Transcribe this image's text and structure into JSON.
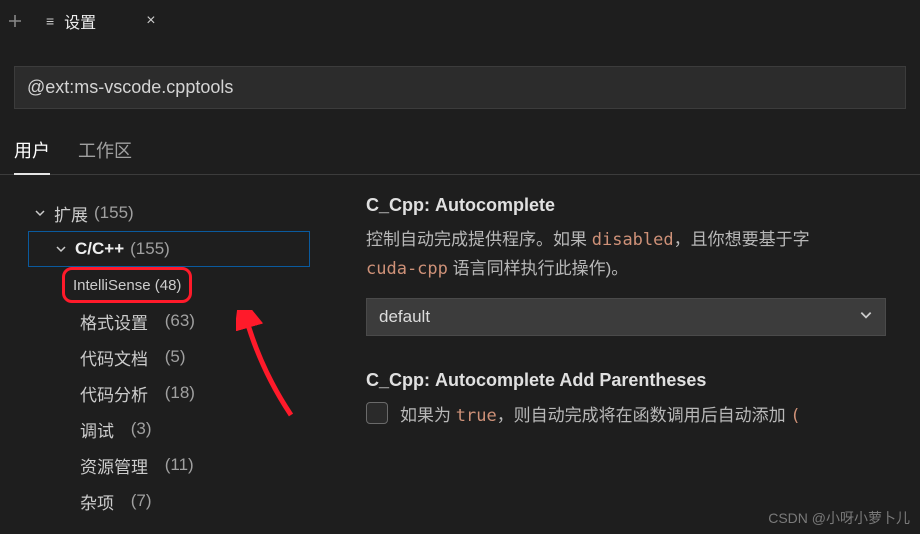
{
  "tab": {
    "icon": "≡",
    "label": "设置",
    "close": "×"
  },
  "search": {
    "value": "@ext:ms-vscode.cpptools"
  },
  "scopes": {
    "user": "用户",
    "workspace": "工作区"
  },
  "tree": {
    "expand": {
      "label": "扩展",
      "count": "(155)"
    },
    "ccpp": {
      "label": "C/C++",
      "count": "(155)"
    },
    "items": [
      {
        "label": "IntelliSense",
        "count": "(48)"
      },
      {
        "label": "格式设置",
        "count": "(63)"
      },
      {
        "label": "代码文档",
        "count": "(5)"
      },
      {
        "label": "代码分析",
        "count": "(18)"
      },
      {
        "label": "调试",
        "count": "(3)"
      },
      {
        "label": "资源管理",
        "count": "(11)"
      },
      {
        "label": "杂项",
        "count": "(7)"
      }
    ]
  },
  "settings": {
    "autocomplete": {
      "prefix": "C_Cpp:",
      "name": "Autocomplete",
      "desc1": "控制自动完成提供程序。如果 ",
      "code1": "disabled",
      "desc2": "，且你想要基于字",
      "desc3": "cuda-cpp",
      "desc4": " 语言同样执行此操作)。",
      "value": "default"
    },
    "addParen": {
      "prefix": "C_Cpp:",
      "name": "Autocomplete Add Parentheses",
      "desc1": "如果为 ",
      "code1": "true",
      "desc2": "，则自动完成将在函数调用后自动添加 ",
      "paren": "("
    }
  },
  "watermark": "CSDN @小呀小萝卜儿"
}
